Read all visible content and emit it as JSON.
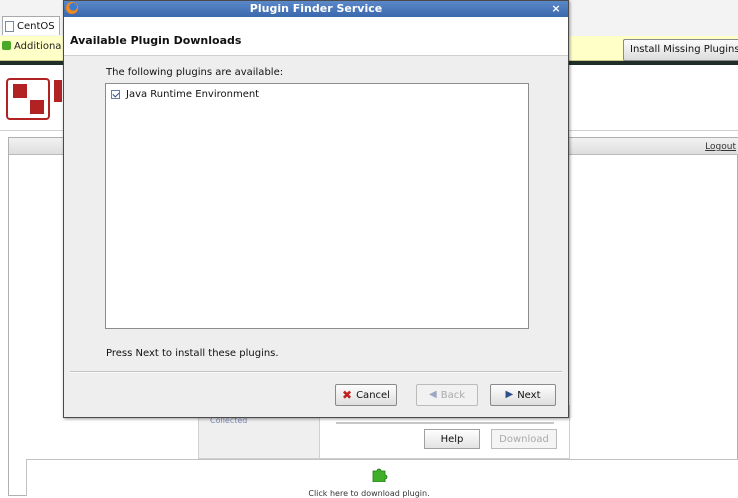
{
  "browser": {
    "tab_title": "CentOS",
    "notification_text": "Additiona",
    "install_missing_label": "Install Missing Plugins...",
    "logout_label": "Logout"
  },
  "page": {
    "collected_label": "Collected",
    "help_label": "Help",
    "download_label": "Download",
    "click_here_label": "Click here to download plugin."
  },
  "dialog": {
    "title": "Plugin Finder Service",
    "close_label": "×",
    "header": "Available Plugin Downloads",
    "available_label": "The following plugins are available:",
    "plugins": [
      {
        "label": "Java Runtime Environment",
        "checked": true
      }
    ],
    "instruction": "Press Next to install these plugins.",
    "buttons": {
      "cancel": "Cancel",
      "back": "Back",
      "next": "Next"
    }
  },
  "colors": {
    "titlebar": "#3b68ad",
    "notification_bg": "#ffffc8",
    "logo_red": "#b22222"
  }
}
